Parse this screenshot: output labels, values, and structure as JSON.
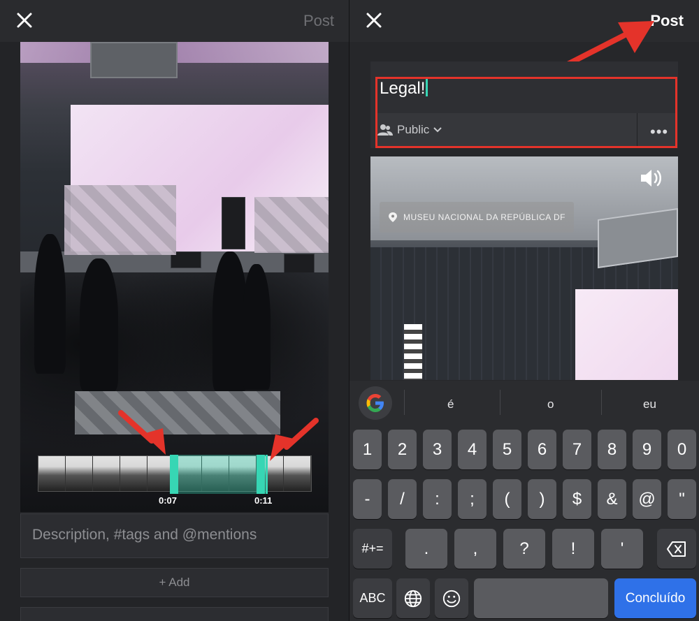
{
  "left_pane": {
    "post_label": "Post",
    "timeline": {
      "start_time": "0:07",
      "end_time": "0:11"
    },
    "description_placeholder": "Description, #tags and @mentions",
    "add_label": "+ Add"
  },
  "right_pane": {
    "post_label": "Post",
    "caption_text": "Legal!",
    "privacy_label": "Public",
    "more_label": "•••",
    "location_label": "MUSEU NACIONAL DA REPÚBLICA DF"
  },
  "keyboard": {
    "suggestions": [
      "é",
      "o",
      "eu"
    ],
    "row1": [
      "1",
      "2",
      "3",
      "4",
      "5",
      "6",
      "7",
      "8",
      "9",
      "0"
    ],
    "row2": [
      "-",
      "/",
      ":",
      ";",
      "(",
      ")",
      "$",
      "&",
      "@",
      "\""
    ],
    "row3": [
      "#+=",
      ".",
      ",",
      "?",
      "!",
      "'"
    ],
    "abc_label": "ABC",
    "done_label": "Concluído"
  },
  "colors": {
    "accent_teal": "#37d6b4",
    "highlight_red": "#e4332a",
    "done_blue": "#2f71e8"
  }
}
